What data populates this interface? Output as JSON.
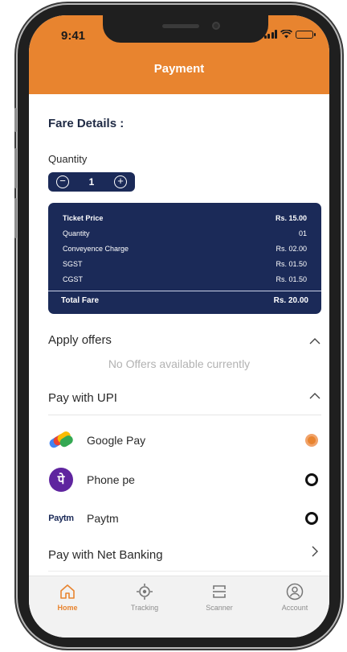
{
  "status_bar": {
    "time": "9:41"
  },
  "header": {
    "title": "Payment"
  },
  "fare": {
    "section_title": "Fare Details :",
    "quantity_label": "Quantity",
    "quantity_value": "1",
    "rows": [
      {
        "label": "Ticket Price",
        "value": "Rs. 15.00",
        "bold": true
      },
      {
        "label": "Quantity",
        "value": "01",
        "bold": false
      },
      {
        "label": "Conveyence Charge",
        "value": "Rs. 02.00",
        "bold": false
      },
      {
        "label": "SGST",
        "value": "Rs. 01.50",
        "bold": false
      },
      {
        "label": "CGST",
        "value": "Rs. 01.50",
        "bold": false
      }
    ],
    "total": {
      "label": "Total Fare",
      "value": "Rs. 20.00"
    }
  },
  "offers": {
    "title": "Apply offers",
    "empty_text": "No Offers available currently"
  },
  "upi": {
    "title": "Pay with UPI",
    "options": [
      {
        "label": "Google Pay",
        "icon": "google-pay-icon",
        "selected": true
      },
      {
        "label": "Phone pe",
        "icon": "phonepe-icon",
        "selected": false
      },
      {
        "label": "Paytm",
        "icon": "paytm-icon",
        "selected": false
      }
    ]
  },
  "paytm_logo_text": "Paytm",
  "phonepe_logo_text": "पे",
  "net_banking": {
    "title": "Pay with Net Banking"
  },
  "tabs": [
    {
      "label": "Home",
      "icon": "home-icon",
      "active": true
    },
    {
      "label": "Tracking",
      "icon": "tracking-icon",
      "active": false
    },
    {
      "label": "Scanner",
      "icon": "scanner-icon",
      "active": false
    },
    {
      "label": "Account",
      "icon": "account-icon",
      "active": false
    }
  ],
  "colors": {
    "accent": "#e8842f",
    "navy": "#1b2a58",
    "muted": "#b2b2b2"
  }
}
